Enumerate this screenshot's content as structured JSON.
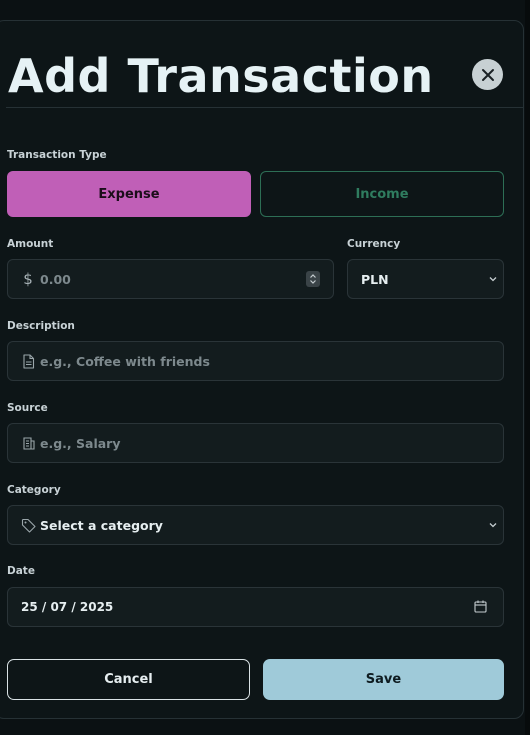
{
  "dialog": {
    "title": "Add Transaction"
  },
  "transaction_type": {
    "label": "Transaction Type",
    "options": [
      "Expense",
      "Income"
    ],
    "selected": "Expense"
  },
  "amount": {
    "label": "Amount",
    "placeholder": "0.00",
    "currency_symbol": "$"
  },
  "currency": {
    "label": "Currency",
    "value": "PLN"
  },
  "description": {
    "label": "Description",
    "placeholder": "e.g., Coffee with friends"
  },
  "source": {
    "label": "Source",
    "placeholder": "e.g., Salary"
  },
  "category": {
    "label": "Category",
    "value": "Select a category"
  },
  "date": {
    "label": "Date",
    "value": "25 / 07 / 2025"
  },
  "actions": {
    "cancel": "Cancel",
    "save": "Save"
  },
  "colors": {
    "expense": "#c05fb7",
    "income": "#2f7c5f",
    "save": "#9fcad9",
    "background": "#0d1517"
  }
}
